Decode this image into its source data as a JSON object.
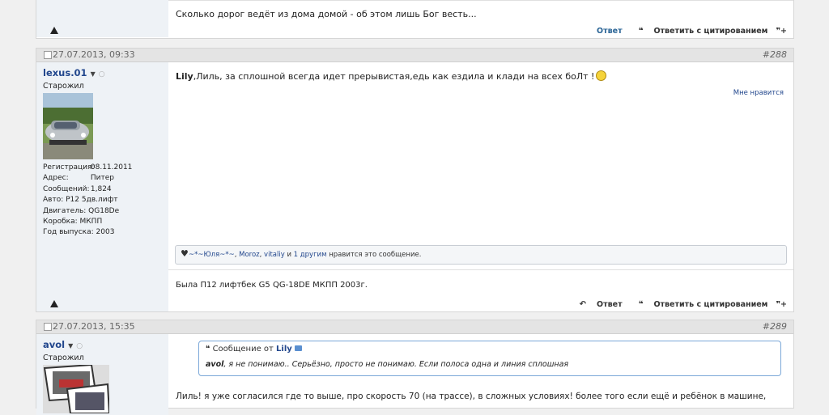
{
  "post_top": {
    "signature": "Сколько дорог ведёт из дома домой - об этом лишь Бог весть...",
    "actions": {
      "reply": "Ответ",
      "quote_reply": "Ответить с цитированием"
    }
  },
  "post288": {
    "date": "27.07.2013, 09:33",
    "number": "#288",
    "username": "lexus.01",
    "rank": "Старожил",
    "info": [
      {
        "k": "Регистрация:",
        "v": "08.11.2011"
      },
      {
        "k": "Адрес:",
        "v": "Питер"
      },
      {
        "k": "Сообщений:",
        "v": "1,824"
      },
      {
        "k": "Авто:",
        "v": "P12 5дв.лифт"
      },
      {
        "k": "Двигатель:",
        "v": "QG18De"
      },
      {
        "k": "Коробка:",
        "v": "МКПП"
      },
      {
        "k": "Год выпуска:",
        "v": "2003"
      }
    ],
    "message_name": "Lily",
    "message_text": ",Лиль, за сплошной всегда идет прерывистая,едь как ездила и клади на всех боЛт !",
    "like_link": "Мне нравится",
    "likes": {
      "user1": "~*~Юля~*~",
      "user2": "Moroz",
      "user3": "vitaliy",
      "and": "и",
      "others": "1 другим",
      "suffix": "нравится это сообщение."
    },
    "signature": "Была П12 лифтбек G5 QG-18DE МКПП 2003г.",
    "actions": {
      "reply": "Ответ",
      "quote_reply": "Ответить с цитированием"
    }
  },
  "post289": {
    "date": "27.07.2013, 15:35",
    "number": "#289",
    "username": "avol",
    "rank": "Старожил",
    "quote_header": "Сообщение от",
    "quote_author": "Lily",
    "quote_user": "avol",
    "quote_text": ", я не понимаю.. Серьёзно, просто не понимаю. Если полоса одна и линия сплошная",
    "message_text": "Лиль! я уже согласился где то выше, про скорость 70 (на трассе), в сложных условиях! более того если ещё и ребёнок в машине,"
  }
}
